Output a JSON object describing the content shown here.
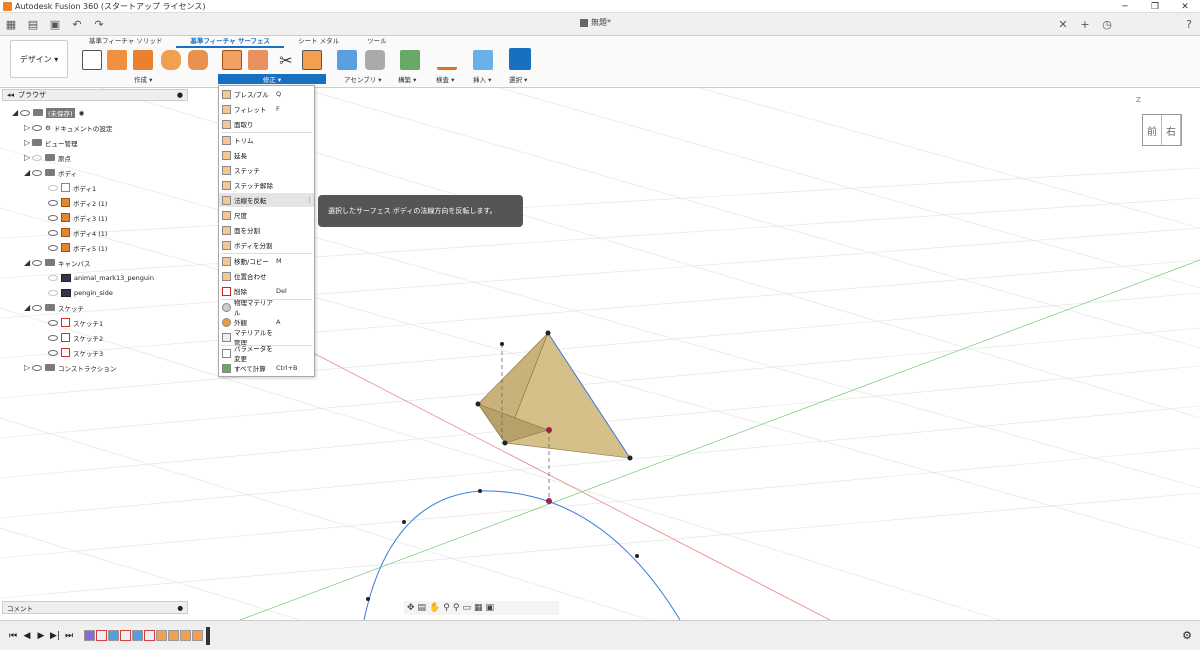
{
  "window": {
    "title": "Autodesk Fusion 360 (スタートアップ ライセンス)",
    "document_name": "無題*"
  },
  "ribbon": {
    "tabs": [
      "基準フィーチャ ソリッド",
      "基準フィーチャ サーフェス",
      "シート メタル",
      "ツール"
    ],
    "active_tab": "基準フィーチャ サーフェス",
    "workspace": "デザイン ▾",
    "groups": [
      "作成 ▾",
      "修正 ▾",
      "アセンブリ ▾",
      "構築 ▾",
      "検査 ▾",
      "挿入 ▾",
      "選択 ▾"
    ]
  },
  "browser": {
    "title": "ブラウザ",
    "items": [
      {
        "label": "(未保存)"
      },
      {
        "label": "ドキュメントの設定"
      },
      {
        "label": "ビュー管理"
      },
      {
        "label": "原点"
      },
      {
        "label": "ボディ"
      },
      {
        "label": "ボディ1"
      },
      {
        "label": "ボディ2 (1)"
      },
      {
        "label": "ボディ3 (1)"
      },
      {
        "label": "ボディ4 (1)"
      },
      {
        "label": "ボディ5 (1)"
      },
      {
        "label": "キャンバス"
      },
      {
        "label": "animal_mark13_penguin"
      },
      {
        "label": "pengin_side"
      },
      {
        "label": "スケッチ"
      },
      {
        "label": "スケッチ1"
      },
      {
        "label": "スケッチ2"
      },
      {
        "label": "スケッチ3"
      },
      {
        "label": "コンストラクション"
      }
    ]
  },
  "modify_menu": {
    "items": [
      {
        "label": "プレス/プル",
        "key": "Q"
      },
      {
        "label": "フィレット",
        "key": "F"
      },
      {
        "label": "面取り",
        "key": ""
      },
      {
        "label": "トリム",
        "key": ""
      },
      {
        "label": "延長",
        "key": ""
      },
      {
        "label": "ステッチ",
        "key": ""
      },
      {
        "label": "ステッチ解除",
        "key": ""
      },
      {
        "label": "法線を反転",
        "key": ""
      },
      {
        "label": "尺度",
        "key": ""
      },
      {
        "label": "面を分割",
        "key": ""
      },
      {
        "label": "ボディを分割",
        "key": ""
      },
      {
        "label": "移動/コピー",
        "key": "M"
      },
      {
        "label": "位置合わせ",
        "key": ""
      },
      {
        "label": "削除",
        "key": "Del"
      },
      {
        "label": "物理マテリアル",
        "key": ""
      },
      {
        "label": "外観",
        "key": "A"
      },
      {
        "label": "マテリアルを管理",
        "key": ""
      },
      {
        "label": "パラメータを変更",
        "key": ""
      },
      {
        "label": "すべて計算",
        "key": "Ctrl+B"
      }
    ]
  },
  "tooltip": {
    "text": "選択したサーフェス ボディの法線方向を反転します。"
  },
  "comments": {
    "label": "コメント"
  },
  "viewcube": {
    "front": "前",
    "right": "右",
    "axis": "Z"
  }
}
